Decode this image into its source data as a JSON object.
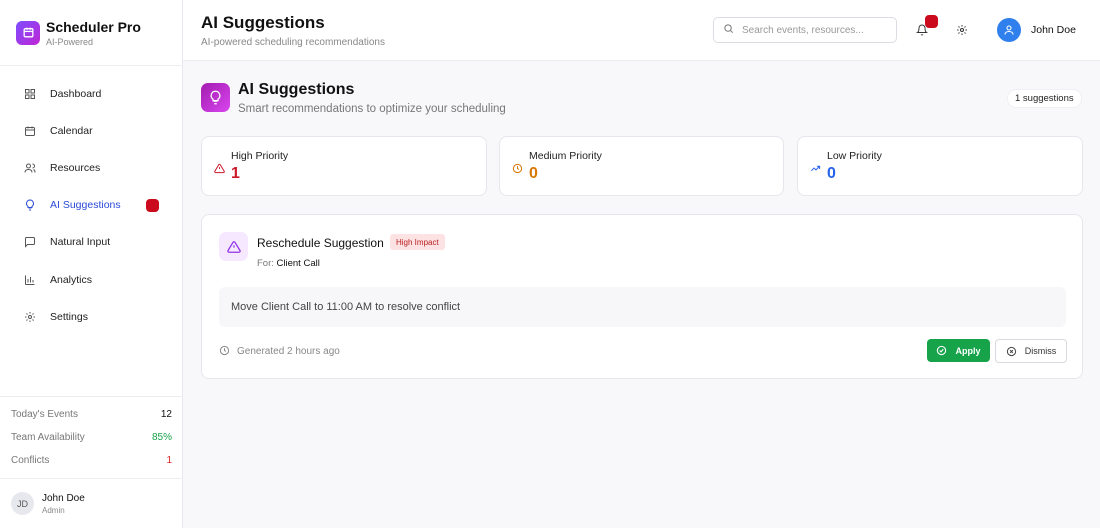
{
  "brand": {
    "title": "Scheduler Pro",
    "subtitle": "AI-Powered"
  },
  "sidebar": {
    "items": [
      {
        "label": "Dashboard",
        "icon": "grid-icon"
      },
      {
        "label": "Calendar",
        "icon": "calendar-icon"
      },
      {
        "label": "Resources",
        "icon": "users-icon"
      },
      {
        "label": "AI Suggestions",
        "icon": "lightbulb-icon",
        "active": true
      },
      {
        "label": "Natural Input",
        "icon": "message-icon"
      },
      {
        "label": "Analytics",
        "icon": "bar-chart-icon"
      },
      {
        "label": "Settings",
        "icon": "gear-icon"
      }
    ],
    "stats": [
      {
        "label": "Today's Events",
        "value": "12"
      },
      {
        "label": "Team Availability",
        "value": "85%"
      },
      {
        "label": "Conflicts",
        "value": "1"
      }
    ],
    "user": {
      "initials": "JD",
      "name": "John Doe",
      "role": "Admin"
    }
  },
  "header": {
    "title": "AI Suggestions",
    "subtitle": "AI-powered scheduling recommendations",
    "search_placeholder": "Search events, resources...",
    "user_name": "John Doe"
  },
  "main": {
    "title": "AI Suggestions",
    "subtitle": "Smart recommendations to optimize your scheduling",
    "count_label": "1 suggestions",
    "cards": [
      {
        "label": "High Priority",
        "value": "1",
        "color": "#cc1a2a"
      },
      {
        "label": "Medium Priority",
        "value": "0",
        "color": "#d97706"
      },
      {
        "label": "Low Priority",
        "value": "0",
        "color": "#2563eb"
      }
    ],
    "suggestion": {
      "title": "Reschedule Suggestion",
      "impact": "High Impact",
      "for_prefix": "For:",
      "for_target": "Client Call",
      "message": "Move Client Call to 11:00 AM to resolve conflict",
      "generated": "Generated 2 hours ago",
      "apply_label": "Apply",
      "dismiss_label": "Dismiss"
    }
  },
  "colors": {
    "accent": "#2a4bd8",
    "apply": "#16a34a",
    "badge": "#cc0a1d"
  }
}
